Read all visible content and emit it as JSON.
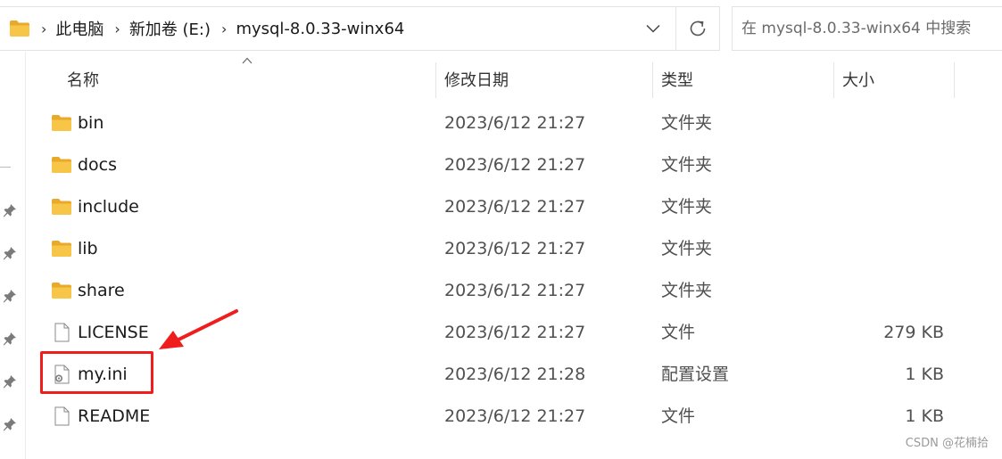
{
  "breadcrumb": {
    "items": [
      "此电脑",
      "新加卷 (E:)",
      "mysql-8.0.33-winx64"
    ],
    "separator": "›"
  },
  "search": {
    "placeholder": "在 mysql-8.0.33-winx64 中搜索"
  },
  "columns": {
    "name": "名称",
    "date": "修改日期",
    "type": "类型",
    "size": "大小"
  },
  "files": [
    {
      "name": "bin",
      "date": "2023/6/12 21:27",
      "type": "文件夹",
      "size": "",
      "icon": "folder-icon"
    },
    {
      "name": "docs",
      "date": "2023/6/12 21:27",
      "type": "文件夹",
      "size": "",
      "icon": "folder-icon"
    },
    {
      "name": "include",
      "date": "2023/6/12 21:27",
      "type": "文件夹",
      "size": "",
      "icon": "folder-icon"
    },
    {
      "name": "lib",
      "date": "2023/6/12 21:27",
      "type": "文件夹",
      "size": "",
      "icon": "folder-icon"
    },
    {
      "name": "share",
      "date": "2023/6/12 21:27",
      "type": "文件夹",
      "size": "",
      "icon": "folder-icon"
    },
    {
      "name": "LICENSE",
      "date": "2023/6/12 21:27",
      "type": "文件",
      "size": "279 KB",
      "icon": "document-icon"
    },
    {
      "name": "my.ini",
      "date": "2023/6/12 21:28",
      "type": "配置设置",
      "size": "1 KB",
      "icon": "config-file-icon"
    },
    {
      "name": "README",
      "date": "2023/6/12 21:27",
      "type": "文件",
      "size": "1 KB",
      "icon": "document-icon"
    }
  ],
  "annotation": {
    "highlighted_file": "my.ini",
    "color": "#f01d1d"
  },
  "watermark": "CSDN @花楠拾",
  "colors": {
    "folder": "#f7c648",
    "folder_dark": "#e9a92a",
    "accent_red": "#f01d1d"
  }
}
